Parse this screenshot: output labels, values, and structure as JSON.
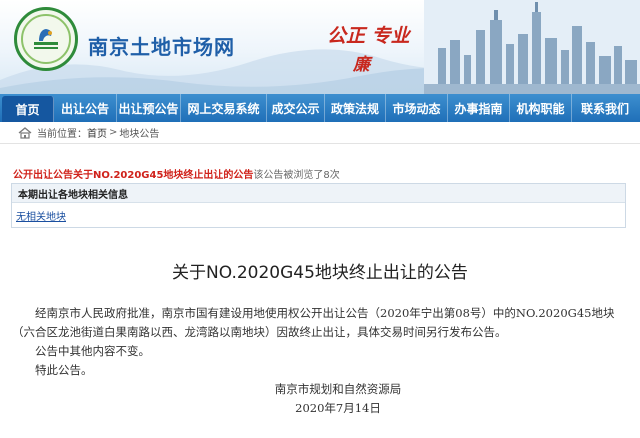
{
  "header": {
    "site_title": "南京土地市场网",
    "slogan_line1": "公正  专业",
    "slogan_line2": "廉",
    "logo_icon": "land-logo-icon"
  },
  "nav": {
    "items": [
      {
        "label": "首页",
        "active": true
      },
      {
        "label": "出让公告"
      },
      {
        "label": "出让预公告"
      },
      {
        "label": "网上交易系统"
      },
      {
        "label": "成交公示"
      },
      {
        "label": "政策法规"
      },
      {
        "label": "市场动态"
      },
      {
        "label": "办事指南"
      },
      {
        "label": "机构职能"
      },
      {
        "label": "联系我们"
      }
    ],
    "bar_color": "#1f6fb8"
  },
  "breadcrumb": {
    "prefix": "当前位置：",
    "home": "首页",
    "separator": ">",
    "current": "地块公告"
  },
  "notice": {
    "title": "公开出让公告关于NO.2020G45地块终止出让的公告",
    "views_text": "该公告被浏览了8次"
  },
  "info_box": {
    "header": "本期出让各地块相关信息",
    "link": "无相关地块"
  },
  "article": {
    "title": "关于NO.2020G45地块终止出让的公告",
    "para1": "经南京市人民政府批准，南京市国有建设用地使用权公开出让公告（2020年宁出第08号）中的NO.2020G45地块（六合区龙池街道白果南路以西、龙湾路以南地块）因故终止出让，具体交易时间另行发布公告。",
    "para2": "公告中其他内容不变。",
    "para3": "特此公告。",
    "signer": "南京市规划和自然资源局",
    "date": "2020年7月14日"
  },
  "colors": {
    "accent_red": "#d0221b",
    "link_blue": "#1a4fa0",
    "title_blue": "#1f5fa8"
  }
}
